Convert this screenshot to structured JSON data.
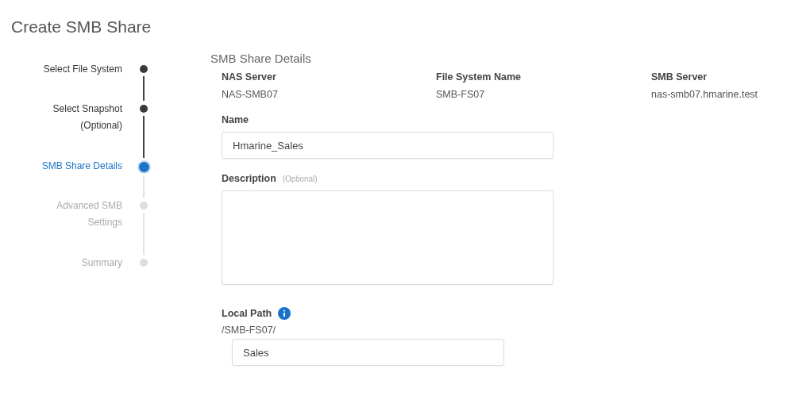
{
  "title": "Create SMB Share",
  "steps": [
    {
      "lines": [
        "Select File System"
      ],
      "completed": true,
      "selected": false
    },
    {
      "lines": [
        "Select Snapshot",
        "(Optional)"
      ],
      "completed": true,
      "selected": false
    },
    {
      "lines": [
        "SMB Share Details"
      ],
      "completed": false,
      "selected": true
    },
    {
      "lines": [
        "Advanced SMB",
        "Settings"
      ],
      "completed": false,
      "selected": false
    },
    {
      "lines": [
        "Summary"
      ],
      "completed": false,
      "selected": false
    }
  ],
  "section_title": "SMB Share Details",
  "info": [
    {
      "label": "NAS Server",
      "value": "NAS-SMB07"
    },
    {
      "label": "File System Name",
      "value": "SMB-FS07"
    },
    {
      "label": "SMB Server",
      "value": "nas-smb07.hmarine.test"
    }
  ],
  "name_field": {
    "label": "Name",
    "value": "Hmarine_Sales"
  },
  "description_field": {
    "label": "Description",
    "hint": "(Optional)"
  },
  "local_path": {
    "label": "Local Path",
    "prefix": "/SMB-FS07/",
    "value": "Sales"
  }
}
